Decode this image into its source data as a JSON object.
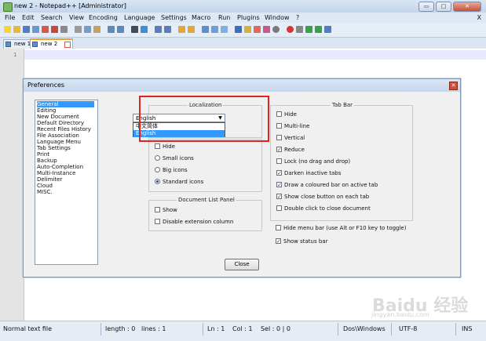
{
  "window": {
    "title": "new 2 - Notepad++ [Administrator]",
    "controls": [
      "▭",
      "□",
      "✕"
    ]
  },
  "menu": {
    "items": [
      "File",
      "Edit",
      "Search",
      "View",
      "Encoding",
      "Language",
      "Settings",
      "Macro",
      "Run",
      "Plugins",
      "Window",
      "?"
    ],
    "close": "X"
  },
  "tabs": [
    {
      "label": "new 1",
      "active": false
    },
    {
      "label": "new 2",
      "active": true
    }
  ],
  "editor": {
    "line_numbers": [
      "1"
    ]
  },
  "dialog": {
    "title": "Preferences",
    "categories": [
      "General",
      "Editing",
      "New Document",
      "Default Directory",
      "Recent Files History",
      "File Association",
      "Language Menu",
      "Tab Settings",
      "Print",
      "Backup",
      "Auto-Completion",
      "Multi-Instance",
      "Delimiter",
      "Cloud",
      "MISC."
    ],
    "selected_category": "General",
    "localization": {
      "label": "Localization",
      "value": "English",
      "options": [
        "中文简体",
        "English"
      ]
    },
    "toolbar_group": {
      "hide": "Hide",
      "small_icons": "Small icons",
      "big_icons": "Big icons",
      "standard_icons": "Standard icons"
    },
    "doc_list_panel": {
      "label": "Document List Panel",
      "show": "Show",
      "disable_ext": "Disable extension column"
    },
    "tab_bar": {
      "label": "Tab Bar",
      "options": [
        {
          "label": "Hide",
          "checked": false
        },
        {
          "label": "Multi-line",
          "checked": false
        },
        {
          "label": "Vertical",
          "checked": false
        },
        {
          "label": "Reduce",
          "checked": true
        },
        {
          "label": "Lock (no drag and drop)",
          "checked": false
        },
        {
          "label": "Darken inactive tabs",
          "checked": true
        },
        {
          "label": "Draw a coloured bar on active tab",
          "checked": true
        },
        {
          "label": "Show close button on each tab",
          "checked": true
        },
        {
          "label": "Double click to close document",
          "checked": false
        }
      ]
    },
    "hide_menu_bar": "Hide menu bar (use Alt or F10 key to toggle)",
    "show_status_bar": "Show status bar",
    "close_button": "Close"
  },
  "status": {
    "file_type": "Normal text file",
    "length": "length : 0",
    "lines": "lines : 1",
    "ln": "Ln : 1",
    "col": "Col : 1",
    "sel": "Sel : 0 | 0",
    "eol": "Dos\\Windows",
    "encoding": "UTF-8",
    "mode": "INS"
  },
  "watermark": {
    "brand": "Baidu 经验",
    "url": "jingyan.baidu.com"
  },
  "colors": {
    "highlight": "#e0231c",
    "selection": "#3399ff"
  }
}
